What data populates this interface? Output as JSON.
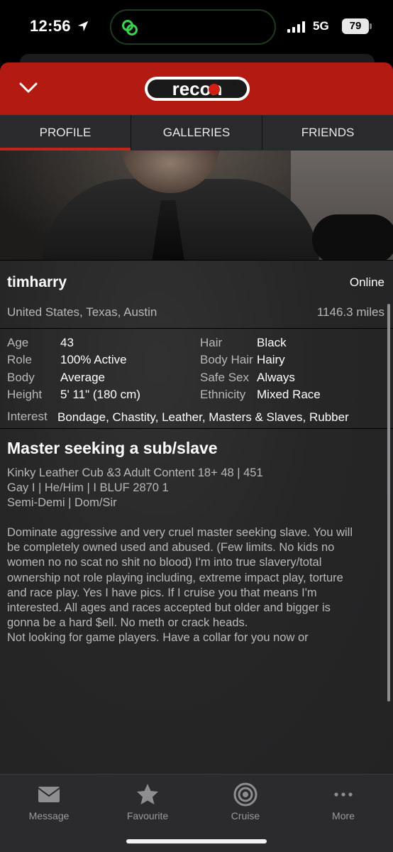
{
  "status_bar": {
    "time": "12:56",
    "network": "5G",
    "battery": "79"
  },
  "header": {
    "logo_text": "recon"
  },
  "tabs": [
    {
      "label": "PROFILE",
      "active": true
    },
    {
      "label": "GALLERIES",
      "active": false
    },
    {
      "label": "FRIENDS",
      "active": false
    }
  ],
  "profile": {
    "username": "timharry",
    "status": "Online",
    "location": "United States, Texas, Austin",
    "distance": "1146.3 miles",
    "stats": [
      {
        "key": "Age",
        "value": "43"
      },
      {
        "key": "Role",
        "value": "100% Active"
      },
      {
        "key": "Body",
        "value": "Average"
      },
      {
        "key": "Height",
        "value": "5' 11\" (180 cm)"
      },
      {
        "key": "Hair",
        "value": "Black"
      },
      {
        "key": "Body Hair",
        "value": "Hairy"
      },
      {
        "key": "Safe Sex",
        "value": "Always"
      },
      {
        "key": "Ethnicity",
        "value": "Mixed Race"
      }
    ],
    "interest_label": "Interest",
    "interest_value": "Bondage, Chastity, Leather, Masters & Slaves, Rubber",
    "headline": "Master seeking a sub/slave",
    "tagline": [
      "Kinky Leather Cub &3 Adult Content 18+ 48 | 451",
      "Gay I | He/Him | I BLUF 2870 1",
      "Semi-Demi | Dom/Sir"
    ],
    "about": "Dominate aggressive and very cruel master seeking slave. You will\nbe completely owned used and abused. (Few limits. No kids no\nwomen no no scat no shit no blood) I'm into true slavery/total\nownership not role playing including, extreme impact play, torture\nand race play. Yes I have pics. If I cruise you that means I'm\ninterested. All ages and races accepted but older and bigger is\ngonna be a hard $ell. No meth or crack heads.\nNot looking for game players. Have a collar for you now or"
  },
  "bottom_nav": [
    {
      "label": "Message",
      "icon": "envelope-icon"
    },
    {
      "label": "Favourite",
      "icon": "star-icon"
    },
    {
      "label": "Cruise",
      "icon": "target-icon"
    },
    {
      "label": "More",
      "icon": "ellipsis-icon"
    }
  ],
  "colors": {
    "brand_red": "#b31b12",
    "panel": "#262628",
    "text_muted": "#b8b8b8"
  }
}
